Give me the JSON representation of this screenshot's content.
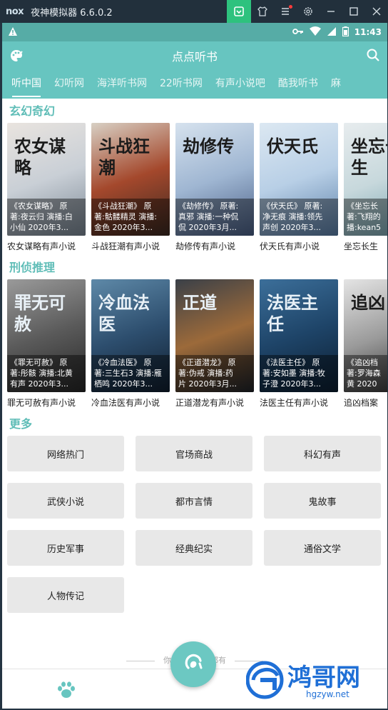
{
  "emulator": {
    "logo": "nox",
    "title": "夜神模拟器 6.6.0.2",
    "controls": [
      "keyboard-icon",
      "shirt-icon",
      "menu-icon",
      "gear-icon",
      "minimize-icon",
      "maximize-icon",
      "close-icon"
    ]
  },
  "status": {
    "time": "11:43"
  },
  "app": {
    "title": "点点听书"
  },
  "tabs": [
    "听中国",
    "幻听网",
    "海洋听书网",
    "22听书网",
    "有声小说吧",
    "酷我听书",
    "麻"
  ],
  "sections": [
    {
      "title": "玄幻奇幻",
      "books": [
        {
          "name": "农女谋略有声小说",
          "line1": "《农女谋略》 原",
          "line2": "著:夜云归 演播:白",
          "line3": "小仙    2020年3...",
          "cover_text": "农女谋略",
          "colors": [
            "#e9e4df",
            "#c9cfd6",
            "#7a8794"
          ]
        },
        {
          "name": "斗战狂潮有声小说",
          "line1": "《斗战狂潮》 原",
          "line2": "著:骷髅精灵 演播:",
          "line3": "金色    2020年3...",
          "cover_text": "斗战狂潮",
          "colors": [
            "#d8d0c4",
            "#a4482c",
            "#3c2a22"
          ]
        },
        {
          "name": "劫修传有声小说",
          "line1": "《劫修传》 原著:",
          "line2": "真邪 演播:一种侃",
          "line3": "侃    2020年3月...",
          "cover_text": "劫修传",
          "colors": [
            "#d6e2ee",
            "#9fb6d2",
            "#4a5f86"
          ]
        },
        {
          "name": "伏天氏有声小说",
          "line1": "《伏天氏》 原著:",
          "line2": "净无痕 演播:领先",
          "line3": "声创    2020年3...",
          "cover_text": "伏天氏",
          "colors": [
            "#dce8f2",
            "#b8cfe6",
            "#5b7fa8"
          ]
        },
        {
          "name": "坐忘长生",
          "line1": "《坐忘长",
          "line2": "著:飞翔的",
          "line3": "播:kean5",
          "cover_text": "坐忘长生",
          "colors": [
            "#e7ecee",
            "#c7d8dc",
            "#6f9fab"
          ]
        }
      ]
    },
    {
      "title": "刑侦推理",
      "books": [
        {
          "name": "罪无可赦有声小说",
          "line1": "《罪无可赦》 原",
          "line2": "著:彤骸 演播:北黄",
          "line3": "有声    2020年3...",
          "cover_text": "罪无可赦",
          "colors": [
            "#9a9a9a",
            "#5a5a5a",
            "#262626"
          ]
        },
        {
          "name": "冷血法医有声小说",
          "line1": "《冷血法医》 原",
          "line2": "著:三生石3 演播:雁",
          "line3": "栖鸣    2020年3...",
          "cover_text": "冷血法医",
          "colors": [
            "#5e89a8",
            "#2d4e6e",
            "#101e2e"
          ]
        },
        {
          "name": "正道潜龙有声小说",
          "line1": "《正道潜龙》 原",
          "line2": "著:伪戒 演播:药",
          "line3": "片    2020年3月...",
          "cover_text": "正道",
          "colors": [
            "#3a4048",
            "#9c6a3a",
            "#1e2228"
          ]
        },
        {
          "name": "法医主任有声小说",
          "line1": "《法医主任》 原",
          "line2": "著:安如墨 演播:牧",
          "line3": "子澄    2020年3...",
          "cover_text": "法医主任",
          "colors": [
            "#3c6f9a",
            "#1e4468",
            "#0c1e30"
          ]
        },
        {
          "name": "追凶档案",
          "line1": "《追凶档",
          "line2": "著:罗海森",
          "line3": "黄    2020",
          "cover_text": "追凶",
          "colors": [
            "#e4e4e4",
            "#9a9a9a",
            "#2a2a2a"
          ]
        }
      ]
    }
  ],
  "more": {
    "title": "更多",
    "items": [
      "网络热门",
      "官场商战",
      "科幻有声",
      "武侠小说",
      "都市言情",
      "鬼故事",
      "历史军事",
      "经典纪实",
      "通俗文学",
      "人物传记"
    ]
  },
  "footer_tip": "你想听的我们都有",
  "watermark": {
    "text": "鸿哥网",
    "url": "hgzyw.net"
  }
}
